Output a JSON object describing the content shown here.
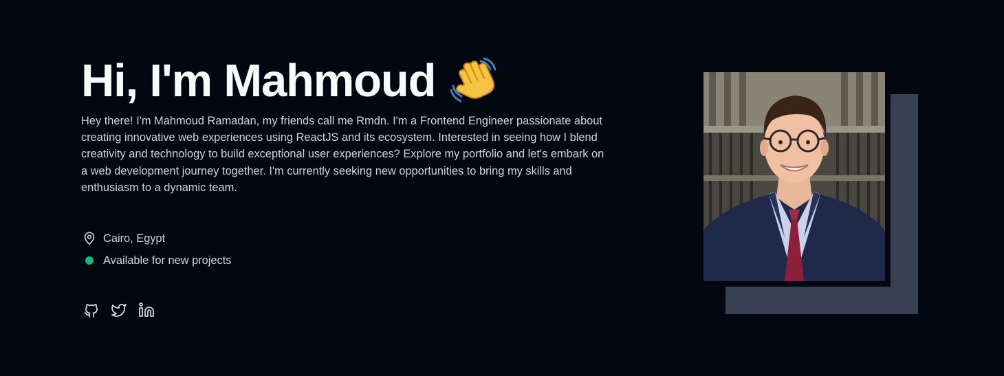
{
  "hero": {
    "title": "Hi, I'm Mahmoud",
    "emoji": "waving-hand",
    "bio": "Hey there! I'm Mahmoud Ramadan, my friends call me Rmdn. I'm a Frontend Engineer passionate about creating innovative web experiences using ReactJS and its ecosystem. Interested in seeing how I blend creativity and technology to build exceptional user experiences? Explore my portfolio and let's embark on a web development journey together. I'm currently seeking new opportunities to bring my skills and enthusiasm to a dynamic team."
  },
  "meta": {
    "location": "Cairo, Egypt",
    "location_icon": "map-pin-icon",
    "status": "Available for new projects",
    "status_color": "#10b981"
  },
  "socials": [
    {
      "icon": "github-icon"
    },
    {
      "icon": "twitter-icon"
    },
    {
      "icon": "linkedin-icon"
    }
  ],
  "colors": {
    "background": "#030712",
    "heading": "#f9fafb",
    "text": "#d1d5db",
    "photo_backdrop": "#374151"
  }
}
